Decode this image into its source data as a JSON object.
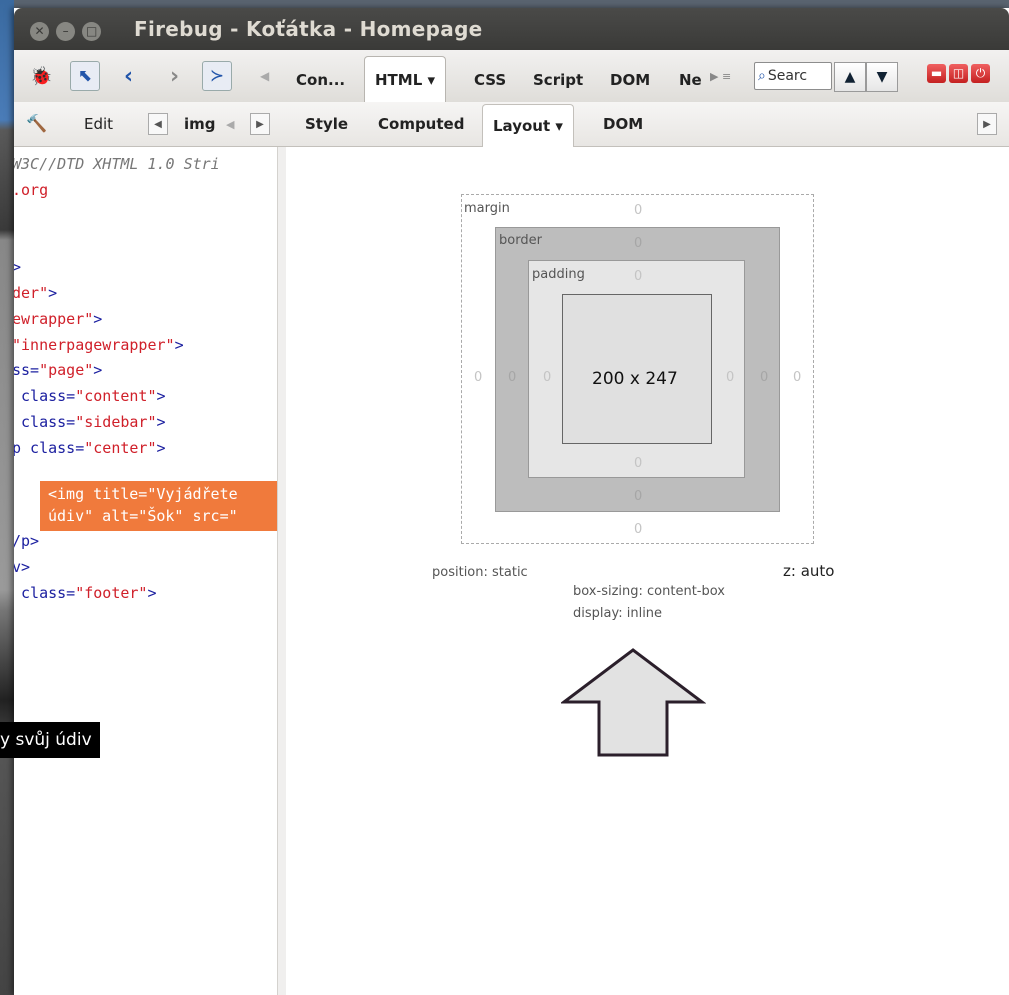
{
  "window": {
    "title": "Firebug - Koťátka - Homepage"
  },
  "tooltip": {
    "text": "y svůj údiv"
  },
  "toolbar": {
    "tabs": [
      "Con...",
      "HTML ▾",
      "CSS",
      "Script",
      "DOM",
      "Ne"
    ],
    "search_placeholder": "Searc"
  },
  "subtoolbar": {
    "edit_label": "Edit",
    "crumb": "img",
    "tabs": [
      "Style",
      "Computed",
      "Layout ▾",
      "DOM"
    ]
  },
  "source": {
    "lines": [
      {
        "cls": "c-com",
        "text": "W3C//DTD XHTML 1.0 Stri"
      },
      {
        "cls": "c-red",
        "text": ".org"
      },
      {
        "cls": "",
        "text": ""
      },
      {
        "cls": "",
        "text": ""
      },
      {
        "cls": "c-blue",
        "text": ">"
      },
      {
        "cls": "",
        "html": "<span class='c-red'>der\"</span><span class='c-blue'>></span>"
      },
      {
        "cls": "",
        "html": "<span class='c-red'>ewrapper\"</span><span class='c-blue'>></span>"
      },
      {
        "cls": "",
        "html": "<span class='c-red'>\"innerpagewrapper\"</span><span class='c-blue'>></span>"
      },
      {
        "cls": "",
        "html": "<span class='c-blue'>ss=</span><span class='c-red'>\"page\"</span><span class='c-blue'>></span>"
      },
      {
        "cls": "",
        "html": "<span class='c-blue'> class=</span><span class='c-red'>\"content\"</span><span class='c-blue'>></span>"
      },
      {
        "cls": "",
        "html": "<span class='c-blue'> class=</span><span class='c-red'>\"sidebar\"</span><span class='c-blue'>></span>"
      },
      {
        "cls": "",
        "html": "<span class='c-blue'>p class=</span><span class='c-red'>\"center\"</span><span class='c-blue'>></span>"
      }
    ],
    "selected_line1": "<img title=\"Vyjádřete",
    "selected_line2": "údiv\" alt=\"Šok\" src=\"",
    "after": [
      "/p>",
      "v>",
      " class=\"footer\">"
    ]
  },
  "layout": {
    "margin_label": "margin",
    "border_label": "border",
    "padding_label": "padding",
    "dimensions": "200 x 247",
    "margin": {
      "top": "0",
      "right": "0",
      "bottom": "0",
      "left": "0"
    },
    "border": {
      "top": "0",
      "right": "0",
      "bottom": "0",
      "left": "0"
    },
    "padding": {
      "top": "0",
      "right": "0",
      "bottom": "0",
      "left": "0"
    },
    "position": "position: static",
    "z": "z: auto",
    "box_sizing": "box-sizing: content-box",
    "display": "display: inline"
  }
}
